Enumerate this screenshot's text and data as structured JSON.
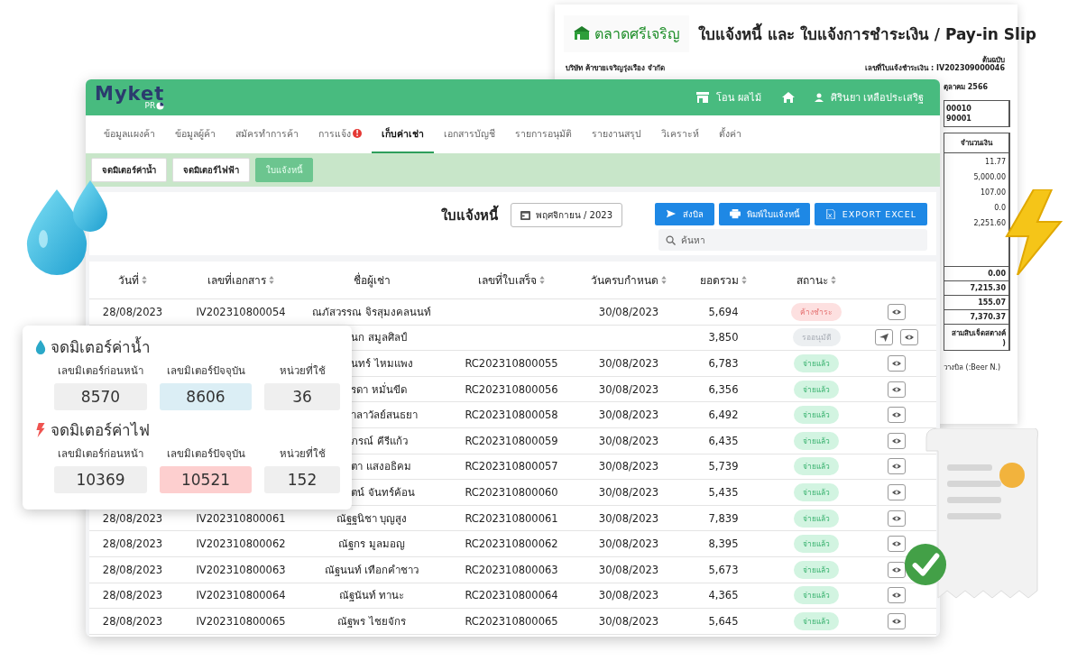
{
  "document": {
    "logo": "ตลาดศรีเจริญ",
    "title": "ใบแจ้งหนี้ และ ใบแจ้งการชำระเงิน / Pay-in Slip",
    "copy_label": "ต้นฉบับ",
    "company": "บริษัท ค้าขายเจริญรุ่งเรือง จำกัด",
    "invoice_no": "เลขที่ใบแจ้งชำระเงิน : IV202309000046",
    "date_fragment": "ตุลาคม 2566",
    "code_fragments": [
      "00010",
      "90001"
    ],
    "amount_header": "จำนวนเงิน",
    "amounts": [
      "11.77",
      "5,000.00",
      "107.00",
      "0.0",
      "2,251.60"
    ],
    "totals": [
      "0.00",
      "7,215.30",
      "155.07",
      "7,370.37"
    ],
    "amount_words_fragment": "สามสิบเจ็ดสตางค์ )",
    "signer_fragment": "วางบิล  (:Beer N.)"
  },
  "app": {
    "brand": "Myket",
    "brand_sub": "PR",
    "store": "โอน ผลไม้",
    "user": "ศิรินยา เหลือประเสริฐ",
    "tabs": [
      {
        "label": "ข้อมูลแผงค้า",
        "selected": false
      },
      {
        "label": "ข้อมูลผู้ค้า",
        "selected": false
      },
      {
        "label": "สมัครทำการค้า",
        "selected": false
      },
      {
        "label": "การแจ้ง",
        "selected": false,
        "badge": "!"
      },
      {
        "label": "เก็บค่าเช่า",
        "selected": true
      },
      {
        "label": "เอกสารบัญชี",
        "selected": false
      },
      {
        "label": "รายการอนุมัติ",
        "selected": false
      },
      {
        "label": "รายงานสรุป",
        "selected": false
      },
      {
        "label": "วิเคราะห์",
        "selected": false
      },
      {
        "label": "ตั้งค่า",
        "selected": false
      }
    ],
    "subtabs": [
      {
        "label": "จดมิเตอร์ค่าน้ำ",
        "selected": false
      },
      {
        "label": "จดมิเตอร์ไฟฟ้า",
        "selected": false
      },
      {
        "label": "ใบแจ้งหนี้",
        "selected": true
      }
    ],
    "page_title": "ใบแจ้งหนี้",
    "period": "พฤศจิกายน / 2023",
    "actions": [
      {
        "kind": "send",
        "label": "ส่งบิล"
      },
      {
        "kind": "print",
        "label": "พิมพ์ใบแจ้งหนี้"
      },
      {
        "kind": "excel",
        "label": "EXPORT EXCEL"
      }
    ],
    "search": {
      "placeholder": "ค้นหา"
    },
    "table": {
      "columns": [
        {
          "label": "วันที่",
          "sortable": true
        },
        {
          "label": "เลขที่เอกสาร",
          "sortable": true
        },
        {
          "label": "ชื่อผู้เช่า",
          "sortable": false
        },
        {
          "label": "เลขที่ใบเสร็จ",
          "sortable": true
        },
        {
          "label": "วันครบกำหนด",
          "sortable": true
        },
        {
          "label": "ยอดรวม",
          "sortable": true
        },
        {
          "label": "สถานะ",
          "sortable": true
        }
      ],
      "rows": [
        {
          "date": "28/08/2023",
          "doc": "IV202310800054",
          "name": "ณภัสวรรณ จิรสุมงคลนนท์",
          "due": "30/08/2023",
          "total": "5,694",
          "status": {
            "kind": "overdue",
            "label": "ค้างชำระ"
          },
          "row_actions": [
            {
              "kind": "view"
            }
          ]
        },
        {
          "name": "นก  สมูลศิลป์",
          "total": "3,850",
          "status": {
            "kind": "pending",
            "label": "รออนุมัติ"
          },
          "row_actions": [
            {
              "kind": "send"
            },
            {
              "kind": "view"
            }
          ]
        },
        {
          "name": "นทร์ ไหมแพง",
          "receipt": "RC202310800055",
          "due": "30/08/2023",
          "total": "6,783",
          "status": {
            "kind": "paid",
            "label": "จ่ายแล้ว"
          },
          "row_actions": [
            {
              "kind": "view"
            }
          ]
        },
        {
          "name": "รดา  หมั่นขีด",
          "receipt": "RC202310800056",
          "due": "30/08/2023",
          "total": "6,356",
          "status": {
            "kind": "paid",
            "label": "จ่ายแล้ว"
          },
          "row_actions": [
            {
              "kind": "view"
            }
          ]
        },
        {
          "name": "าลาวัลย์สนธยา",
          "receipt": "RC202310800058",
          "due": "30/08/2023",
          "total": "6,492",
          "status": {
            "kind": "paid",
            "label": "จ่ายแล้ว"
          },
          "row_actions": [
            {
              "kind": "view"
            }
          ]
        },
        {
          "name": "ภรณ์  คีรีแก้ว",
          "receipt": "RC202310800059",
          "due": "30/08/2023",
          "total": "6,435",
          "status": {
            "kind": "paid",
            "label": "จ่ายแล้ว"
          },
          "row_actions": [
            {
              "kind": "view"
            }
          ]
        },
        {
          "name": "ตา  แสงอธิคม",
          "receipt": "RC202310800057",
          "due": "30/08/2023",
          "total": "5,739",
          "status": {
            "kind": "paid",
            "label": "จ่ายแล้ว"
          },
          "row_actions": [
            {
              "kind": "view"
            }
          ]
        },
        {
          "name": "ตน์ จันทร์ค้อน",
          "receipt": "RC202310800060",
          "due": "30/08/2023",
          "total": "5,435",
          "status": {
            "kind": "paid",
            "label": "จ่ายแล้ว"
          },
          "row_actions": [
            {
              "kind": "view"
            }
          ]
        },
        {
          "date": "28/08/2023",
          "doc": "IV202310800061",
          "name": "ณัฐฐนิชา  บุญสูง",
          "receipt": "RC202310800061",
          "due": "30/08/2023",
          "total": "7,839",
          "status": {
            "kind": "paid",
            "label": "จ่ายแล้ว"
          },
          "row_actions": [
            {
              "kind": "view"
            }
          ]
        },
        {
          "date": "28/08/2023",
          "doc": "IV202310800062",
          "name": "ณัฐกร  มูลมอญ",
          "receipt": "RC202310800062",
          "due": "30/08/2023",
          "total": "8,395",
          "status": {
            "kind": "paid",
            "label": "จ่ายแล้ว"
          },
          "row_actions": [
            {
              "kind": "view"
            }
          ]
        },
        {
          "date": "28/08/2023",
          "doc": "IV202310800063",
          "name": "ณัฐนนท์ เทือกคำชาว",
          "receipt": "RC202310800063",
          "due": "30/08/2023",
          "total": "5,673",
          "status": {
            "kind": "paid",
            "label": "จ่ายแล้ว"
          },
          "row_actions": [
            {
              "kind": "view"
            }
          ]
        },
        {
          "date": "28/08/2023",
          "doc": "IV202310800064",
          "name": "ณัฐนันท์ ทานะ",
          "receipt": "RC202310800064",
          "due": "30/08/2023",
          "total": "4,365",
          "status": {
            "kind": "paid",
            "label": "จ่ายแล้ว"
          },
          "row_actions": [
            {
              "kind": "view"
            }
          ]
        },
        {
          "date": "28/08/2023",
          "doc": "IV202310800065",
          "name": "ณัฐพร  ไชยจักร",
          "receipt": "RC202310800065",
          "due": "30/08/2023",
          "total": "5,645",
          "status": {
            "kind": "paid",
            "label": "จ่ายแล้ว"
          },
          "row_actions": [
            {
              "kind": "view"
            }
          ]
        }
      ]
    }
  },
  "meters": [
    {
      "kind": "water",
      "title": "จดมิเตอร์ค่าน้ำ",
      "labels": [
        "เลขมิเตอร์ก่อนหน้า",
        "เลขมิเตอร์ปัจจุบัน",
        "หน่วยที่ใช้"
      ],
      "previous": "8570",
      "current": "8606",
      "used": "36"
    },
    {
      "kind": "electric",
      "title": "จดมิเตอร์ค่าไฟ",
      "labels": [
        "เลขมิเตอร์ก่อนหน้า",
        "เลขมิเตอร์ปัจจุบัน",
        "หน่วยที่ใช้"
      ],
      "previous": "10369",
      "current": "10521",
      "used": "152"
    }
  ]
}
